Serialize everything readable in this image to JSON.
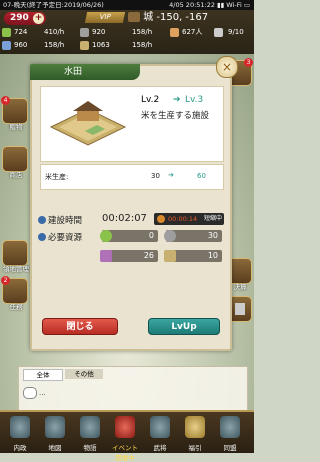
{
  "status_bar": {
    "left": "07-晩天(終了予定日:2019/06/26)",
    "right": "4/05 20:51:22 ▮▮ Wi-Fi ▭"
  },
  "header": {
    "gold": "290",
    "plus": "+",
    "vip": "VIP",
    "castle": "城 -150, -167",
    "row1": [
      {
        "value": "724",
        "rate": "410/h",
        "color": "#8bc34a"
      },
      {
        "value": "920",
        "rate": "158/h",
        "color": "#9e9e9e"
      },
      {
        "value": "627人",
        "rate": "",
        "color": "#e0a060"
      },
      {
        "value": "9/10",
        "rate": "",
        "color": "#cccccc"
      }
    ],
    "row2": [
      {
        "value": "960",
        "rate": "158/h",
        "color": "#7aa0d8"
      },
      {
        "value": "1063",
        "rate": "158/h",
        "color": "#c8b070"
      }
    ]
  },
  "side": {
    "left": [
      {
        "label": "贈物",
        "badge": "4"
      },
      {
        "label": "商店",
        "badge": ""
      },
      {
        "label": "領地管理",
        "badge": ""
      },
      {
        "label": "任務",
        "badge": "2"
      }
    ],
    "right": [
      {
        "label": "",
        "badge": "3"
      },
      {
        "label": "決算",
        "badge": ""
      }
    ]
  },
  "dialog": {
    "title": "水田",
    "close": "×",
    "level_from": "Lv.2",
    "arrow": "➔",
    "level_to": "Lv.3",
    "description": "米を生産する施設",
    "production": {
      "label": "米生産:",
      "from": "30",
      "to": "60"
    },
    "build_time": {
      "label": "建設時間",
      "value": "00:02:07",
      "reduced": "00:00:14",
      "reduced_tag": "短縮中"
    },
    "resources": {
      "label": "必要資源",
      "items": [
        {
          "value": "0",
          "color": "#8bc34a"
        },
        {
          "value": "30",
          "color": "#9e9e9e"
        },
        {
          "value": "26",
          "color": "#7aa0d8"
        },
        {
          "value": "10",
          "color": "#c8b070"
        }
      ]
    },
    "close_button": "閉じる",
    "lvup_button": "LvUp"
  },
  "chat": {
    "tabs": [
      "全体",
      "その他"
    ],
    "message": "..."
  },
  "nav": [
    "内政",
    "地図",
    "物語",
    "イベント開催中",
    "武将",
    "福引",
    "同盟"
  ]
}
